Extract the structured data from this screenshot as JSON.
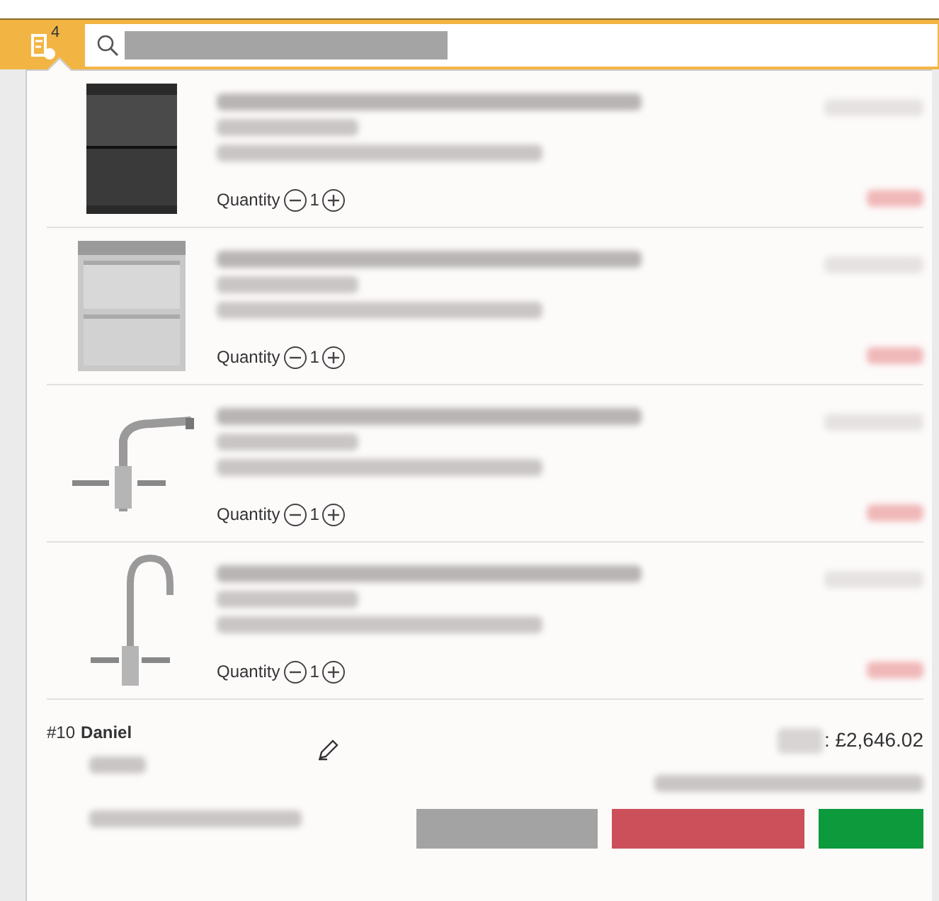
{
  "cart_badge": "4",
  "items": [
    {
      "kind": "dishwasher-dark",
      "quantity_label": "Quantity",
      "quantity": "1"
    },
    {
      "kind": "dishwasher-steel",
      "quantity_label": "Quantity",
      "quantity": "1"
    },
    {
      "kind": "tap-lever",
      "quantity_label": "Quantity",
      "quantity": "1"
    },
    {
      "kind": "tap-swan",
      "quantity_label": "Quantity",
      "quantity": "1"
    }
  ],
  "order": {
    "number": "#10",
    "customer": "Daniel",
    "total": ": £2,646.02"
  }
}
